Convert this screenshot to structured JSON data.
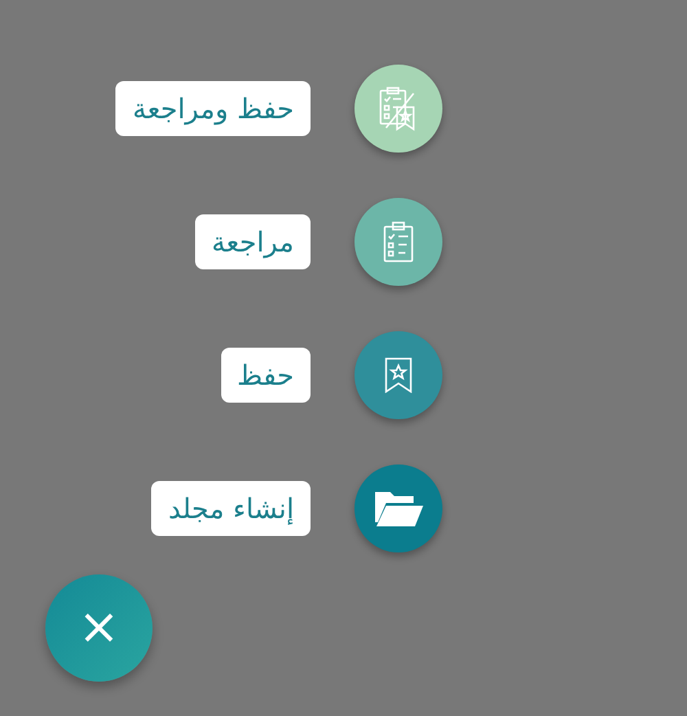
{
  "actions": [
    {
      "label": "حفظ ومراجعة",
      "kind": "save-review",
      "color": "#a6d5b4"
    },
    {
      "label": "مراجعة",
      "kind": "review",
      "color": "#6cb6a8"
    },
    {
      "label": "حفظ",
      "kind": "save",
      "color": "#2f8f9b"
    },
    {
      "label": "إنشاء مجلد",
      "kind": "folder",
      "color": "#0b7d8e"
    }
  ],
  "close_button": {
    "symbol": "×"
  }
}
